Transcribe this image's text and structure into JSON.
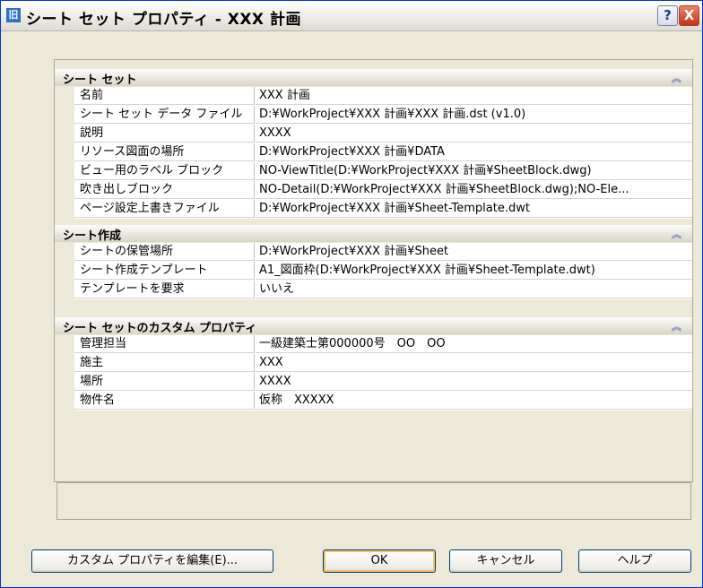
{
  "window": {
    "title": "シート セット プロパティ - XXX 計画",
    "icon_glyph": "旧"
  },
  "titlebar_buttons": {
    "help": "?",
    "close": "X"
  },
  "sections": [
    {
      "title": "シート セット",
      "rows": [
        {
          "key": "名前",
          "value": "XXX 計画"
        },
        {
          "key": "シート セット データ ファイル",
          "value": "D:¥WorkProject¥XXX 計画¥XXX 計画.dst (v1.0)"
        },
        {
          "key": "説明",
          "value": "XXXX"
        },
        {
          "key": "リソース図面の場所",
          "value": "D:¥WorkProject¥XXX 計画¥DATA"
        },
        {
          "key": "ビュー用のラベル ブロック",
          "value": "NO-ViewTitle(D:¥WorkProject¥XXX 計画¥SheetBlock.dwg)"
        },
        {
          "key": "吹き出しブロック",
          "value": "NO-Detail(D:¥WorkProject¥XXX 計画¥SheetBlock.dwg);NO-Ele..."
        },
        {
          "key": "ページ設定上書きファイル",
          "value": "D:¥WorkProject¥XXX 計画¥Sheet-Template.dwt"
        }
      ]
    },
    {
      "title": "シート作成",
      "rows": [
        {
          "key": "シートの保管場所",
          "value": "D:¥WorkProject¥XXX 計画¥Sheet"
        },
        {
          "key": "シート作成テンプレート",
          "value": "A1_図面枠(D:¥WorkProject¥XXX 計画¥Sheet-Template.dwt)"
        },
        {
          "key": "テンプレートを要求",
          "value": "いいえ"
        }
      ]
    },
    {
      "title": "シート セットのカスタム プロパティ",
      "rows": [
        {
          "key": "管理担当",
          "value": "一級建築士第000000号　OO　OO"
        },
        {
          "key": "施主",
          "value": "XXX"
        },
        {
          "key": "場所",
          "value": "XXXX"
        },
        {
          "key": "物件名",
          "value": "仮称　XXXXX"
        }
      ]
    }
  ],
  "buttons": {
    "edit_custom": "カスタム プロパティを編集(E)...",
    "ok": "OK",
    "cancel": "キャンセル",
    "help": "ヘルプ"
  }
}
